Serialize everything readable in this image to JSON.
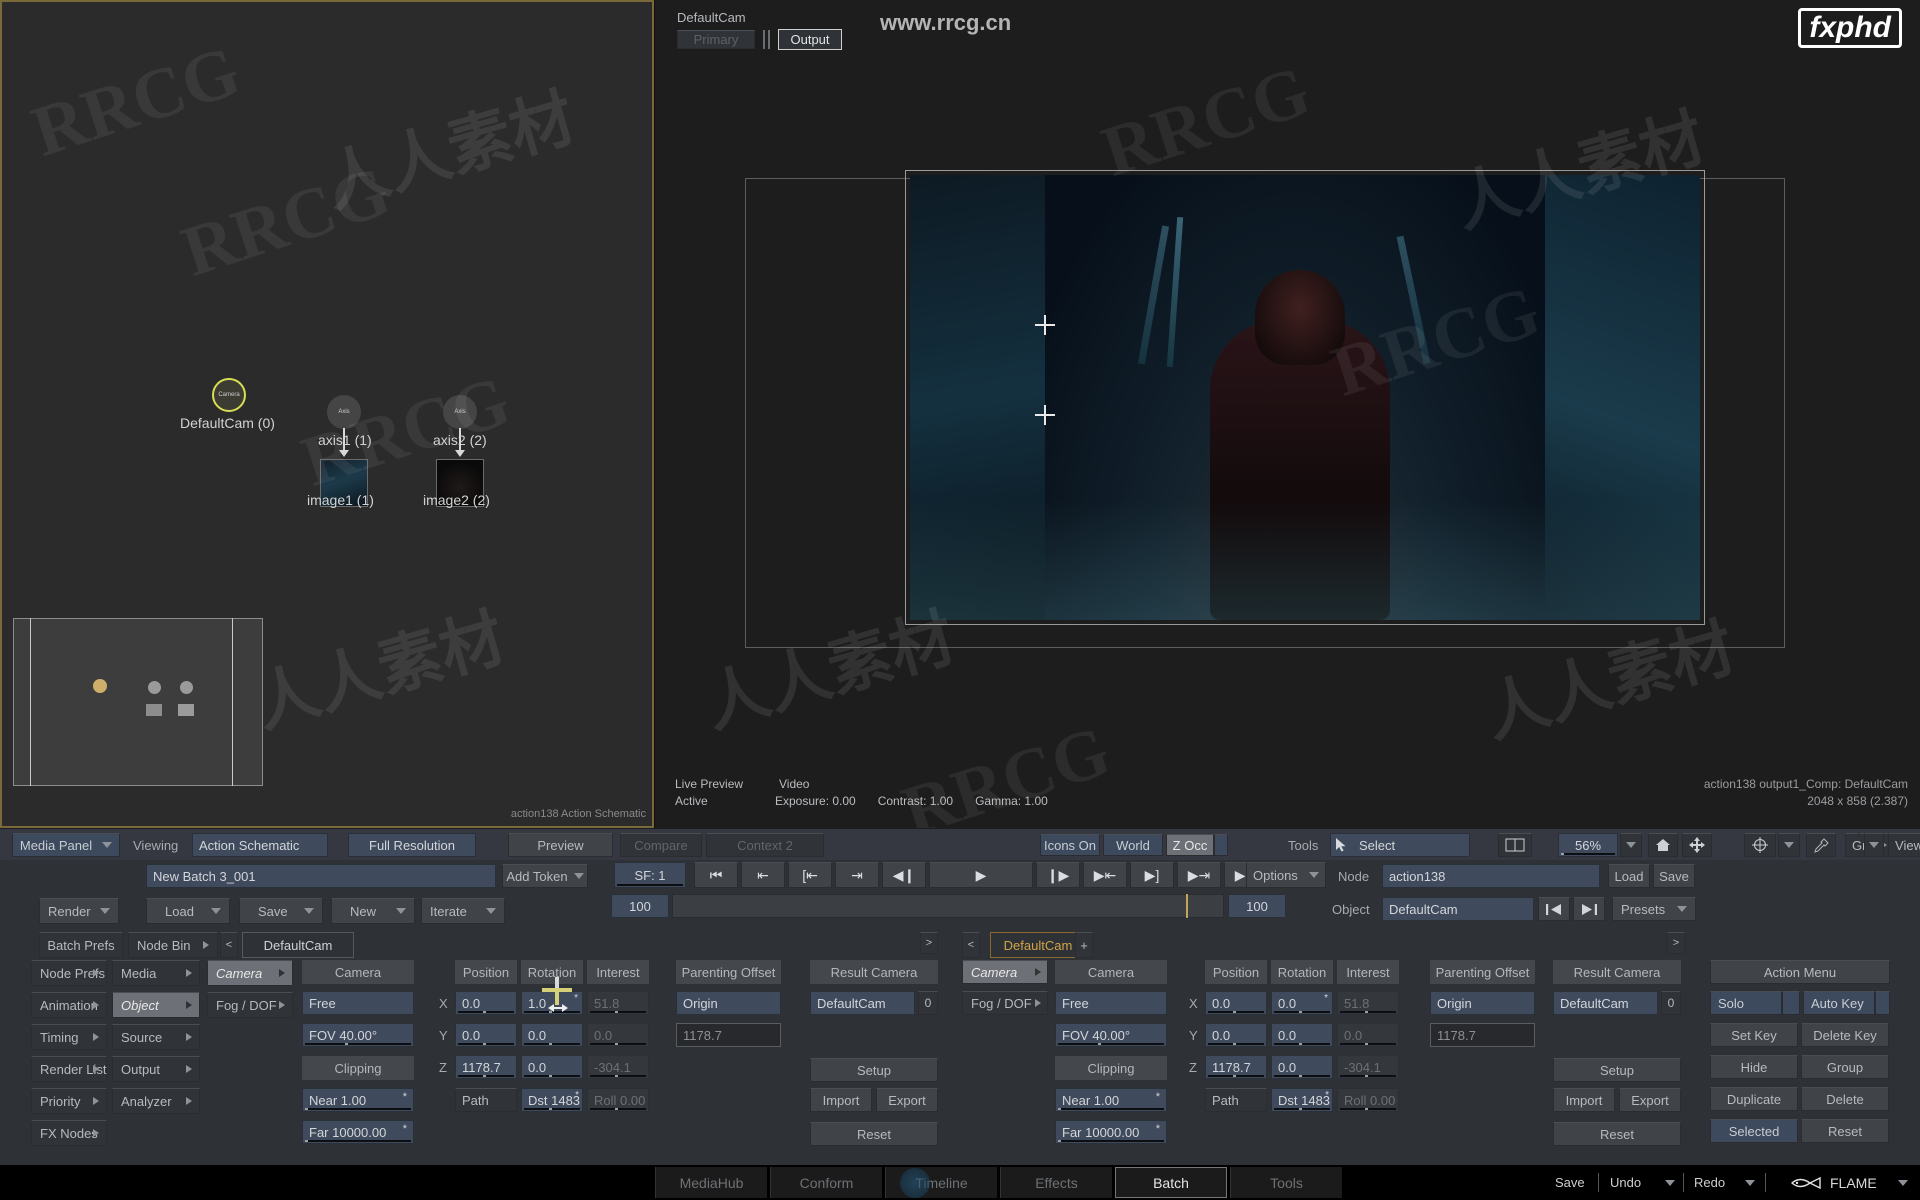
{
  "viewer": {
    "cam_label": "DefaultCam",
    "primary_btn": "Primary",
    "output_btn": "Output",
    "watermark_url": "www.rrcg.cn",
    "brand": "fxphd",
    "footer_left": {
      "live_preview": "Live Preview",
      "video": "Video",
      "active": "Active",
      "exposure": "Exposure: 0.00",
      "contrast": "Contrast: 1.00",
      "gamma": "Gamma: 1.00"
    },
    "footer_right": {
      "line1": "action138 output1_Comp: DefaultCam",
      "line2": "2048 x 858 (2.387)"
    }
  },
  "schematic": {
    "footer": "action138 Action Schematic",
    "nodes": [
      {
        "icon_label": "Camera",
        "label": "DefaultCam (0)"
      },
      {
        "icon_label": "Axis",
        "label": "axis1 (1)"
      },
      {
        "icon_label": "Axis",
        "label": "axis2 (2)"
      },
      {
        "label": "image1 (1)"
      },
      {
        "label": "image2 (2)"
      }
    ]
  },
  "toolbar": {
    "media_panel": "Media Panel",
    "viewing_label": "Viewing",
    "viewing_value": "Action Schematic",
    "full_resolution": "Full Resolution",
    "preview": "Preview",
    "compare": "Compare",
    "context": "Context 2",
    "icons_on": "Icons On",
    "world": "World",
    "z_occ": "Z Occ",
    "tools_label": "Tools",
    "select": "Select",
    "zoom_value": "56%",
    "grid": "Grid",
    "view": "View"
  },
  "batch": {
    "name_field": "New Batch 3_001",
    "add_token": "Add Token",
    "render": "Render",
    "load": "Load",
    "save": "Save",
    "new": "New",
    "iterate": "Iterate",
    "batch_prefs": "Batch Prefs",
    "node_bin": "Node Bin",
    "prev_arrow": "<",
    "tab_defaultcam": "DefaultCam"
  },
  "sidebar_col1": [
    "Node Prefs",
    "Animation",
    "Timing",
    "Render List",
    "Priority",
    "FX Nodes"
  ],
  "sidebar_col2": [
    "Media",
    "Object",
    "Source",
    "Output",
    "Analyzer"
  ],
  "sidebar_col3": [
    "Camera",
    "Fog / DOF"
  ],
  "transport": {
    "sf_label": "SF: 1",
    "options": "Options",
    "buttons": [
      "⏮",
      "⇤",
      "[⇤",
      "⇥",
      "◀❙",
      "▶",
      "❙▶",
      "▶⇤",
      "▶]",
      "▶⇥",
      "▶❙"
    ],
    "range_start": "100",
    "range_end": "100"
  },
  "node_row": {
    "node_label": "Node",
    "node_value": "action138",
    "load": "Load",
    "save": "Save",
    "object_label": "Object",
    "object_value": "DefaultCam",
    "presets": "Presets"
  },
  "camera_panel_left": {
    "tab_camera": "Camera",
    "tab_fog": "Fog / DOF",
    "header": "Camera",
    "mode": "Free",
    "fov": "FOV 40.00°",
    "clipping": "Clipping",
    "near": "Near 1.00",
    "far": "Far 10000.00",
    "col_position": "Position",
    "col_rotation": "Rotation",
    "col_interest": "Interest",
    "axes": [
      "X",
      "Y",
      "Z"
    ],
    "position": [
      "0.0",
      "0.0",
      "1178.7"
    ],
    "rotation": [
      "1.0",
      "0.0",
      "0.0"
    ],
    "interest": [
      "51.8",
      "0.0",
      "-304.1"
    ],
    "path_label": "Path",
    "dst": "Dst 1483",
    "roll": "Roll 0.00",
    "parenting_offset": "Parenting Offset",
    "origin": "Origin",
    "offset_value": "1178.7",
    "result_camera": "Result Camera",
    "result_value": "DefaultCam",
    "result_index": "0",
    "setup": "Setup",
    "import": "Import",
    "export": "Export",
    "reset": "Reset"
  },
  "camera_panel_right": {
    "tab_camera": "Camera",
    "tab_fog": "Fog / DOF",
    "header": "Camera",
    "mode": "Free",
    "fov": "FOV 40.00°",
    "clipping": "Clipping",
    "near": "Near 1.00",
    "far": "Far 10000.00",
    "col_position": "Position",
    "col_rotation": "Rotation",
    "col_interest": "Interest",
    "axes": [
      "X",
      "Y",
      "Z"
    ],
    "position": [
      "0.0",
      "0.0",
      "1178.7"
    ],
    "rotation": [
      "0.0",
      "0.0",
      "0.0"
    ],
    "interest": [
      "51.8",
      "0.0",
      "-304.1"
    ],
    "path_label": "Path",
    "dst": "Dst 1483",
    "roll": "Roll 0.00",
    "parenting_offset": "Parenting Offset",
    "origin": "Origin",
    "offset_value": "1178.7",
    "result_camera": "Result Camera",
    "result_value": "DefaultCam",
    "result_index": "0",
    "setup": "Setup",
    "import": "Import",
    "export": "Export",
    "reset": "Reset",
    "tab_label": "DefaultCam",
    "plus": "+"
  },
  "action_menu": {
    "title": "Action Menu",
    "solo": "Solo",
    "auto_key": "Auto Key",
    "set_key": "Set Key",
    "delete_key": "Delete Key",
    "hide": "Hide",
    "group": "Group",
    "duplicate": "Duplicate",
    "delete": "Delete",
    "selected": "Selected",
    "reset": "Reset"
  },
  "footer_tabs": [
    "MediaHub",
    "Conform",
    "Timeline",
    "Effects",
    "Batch",
    "Tools"
  ],
  "footer_right": {
    "save": "Save",
    "undo": "Undo",
    "redo": "Redo",
    "flame": "FLAME"
  },
  "colors": {
    "accent": "#d9dd52",
    "panel": "#2e3136",
    "field": "#3f4a5c",
    "orange": "#c79a3c"
  }
}
